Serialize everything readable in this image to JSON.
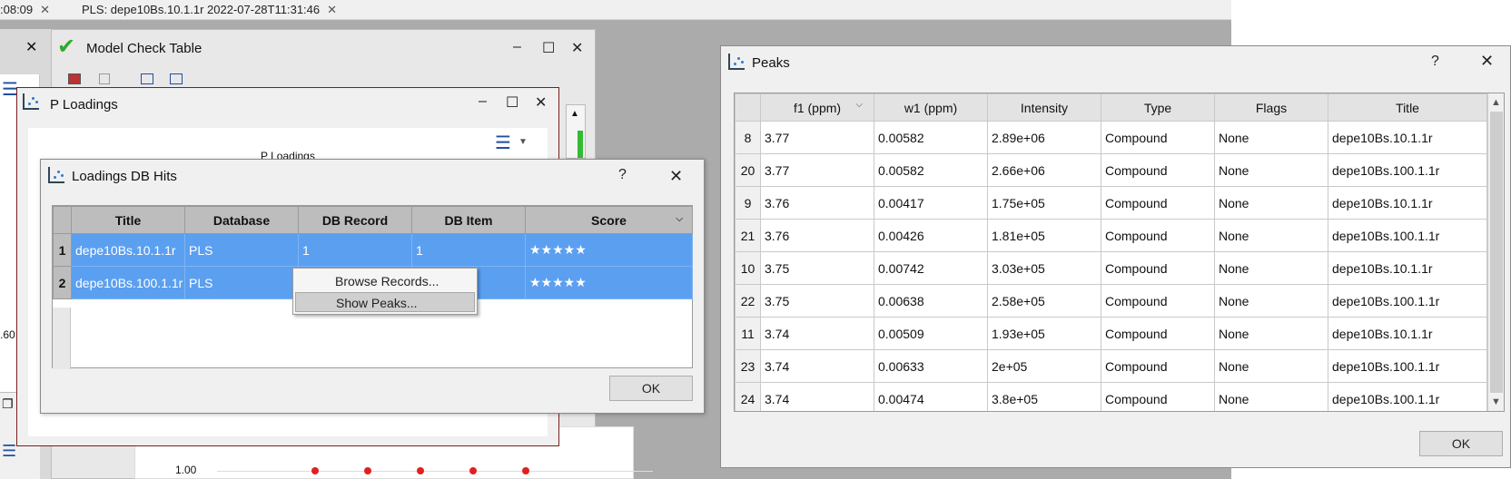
{
  "tabs": [
    {
      "label": ":08:09"
    },
    {
      "label": "PLS: depe10Bs.10.1.1r 2022-07-28T11:31:46"
    }
  ],
  "model_check_table": {
    "title": "Model Check Table",
    "plot_tick": "1.00",
    "left_tick": ".60"
  },
  "p_loadings": {
    "title": "P Loadings",
    "plot_title": "P Loadings"
  },
  "db_hits": {
    "title": "Loadings DB Hits",
    "help": "?",
    "columns": [
      "Title",
      "Database",
      "DB Record",
      "DB Item",
      "Score"
    ],
    "rows": [
      {
        "num": "1",
        "title": "depe10Bs.10.1.1r",
        "database": "PLS",
        "record": "1",
        "item": "1",
        "score": "★★★★★"
      },
      {
        "num": "2",
        "title": "depe10Bs.100.1.1r",
        "database": "PLS",
        "record": "",
        "item": "",
        "score": "★★★★★"
      }
    ],
    "ok_label": "OK"
  },
  "context_menu": {
    "items": [
      "Browse Records...",
      "Show Peaks..."
    ]
  },
  "peaks": {
    "title": "Peaks",
    "help": "?",
    "columns": [
      "f1 (ppm)",
      "w1 (ppm)",
      "Intensity",
      "Type",
      "Flags",
      "Title"
    ],
    "rows": [
      {
        "num": "8",
        "f1": "3.77",
        "w1": "0.00582",
        "intensity": "2.89e+06",
        "type": "Compound",
        "flags": "None",
        "title": "depe10Bs.10.1.1r"
      },
      {
        "num": "20",
        "f1": "3.77",
        "w1": "0.00582",
        "intensity": "2.66e+06",
        "type": "Compound",
        "flags": "None",
        "title": "depe10Bs.100.1.1r"
      },
      {
        "num": "9",
        "f1": "3.76",
        "w1": "0.00417",
        "intensity": "1.75e+05",
        "type": "Compound",
        "flags": "None",
        "title": "depe10Bs.10.1.1r"
      },
      {
        "num": "21",
        "f1": "3.76",
        "w1": "0.00426",
        "intensity": "1.81e+05",
        "type": "Compound",
        "flags": "None",
        "title": "depe10Bs.100.1.1r"
      },
      {
        "num": "10",
        "f1": "3.75",
        "w1": "0.00742",
        "intensity": "3.03e+05",
        "type": "Compound",
        "flags": "None",
        "title": "depe10Bs.10.1.1r"
      },
      {
        "num": "22",
        "f1": "3.75",
        "w1": "0.00638",
        "intensity": "2.58e+05",
        "type": "Compound",
        "flags": "None",
        "title": "depe10Bs.100.1.1r"
      },
      {
        "num": "11",
        "f1": "3.74",
        "w1": "0.00509",
        "intensity": "1.93e+05",
        "type": "Compound",
        "flags": "None",
        "title": "depe10Bs.10.1.1r"
      },
      {
        "num": "23",
        "f1": "3.74",
        "w1": "0.00633",
        "intensity": "2e+05",
        "type": "Compound",
        "flags": "None",
        "title": "depe10Bs.100.1.1r"
      },
      {
        "num": "24",
        "f1": "3.74",
        "w1": "0.00474",
        "intensity": "3.8e+05",
        "type": "Compound",
        "flags": "None",
        "title": "depe10Bs.100.1.1r"
      }
    ],
    "ok_label": "OK"
  },
  "colors": {
    "selection": "#5b9ff0",
    "check_green": "#2eaa2e",
    "plot_dot": "#e02020",
    "ploadings_border": "#7a1e1e"
  }
}
